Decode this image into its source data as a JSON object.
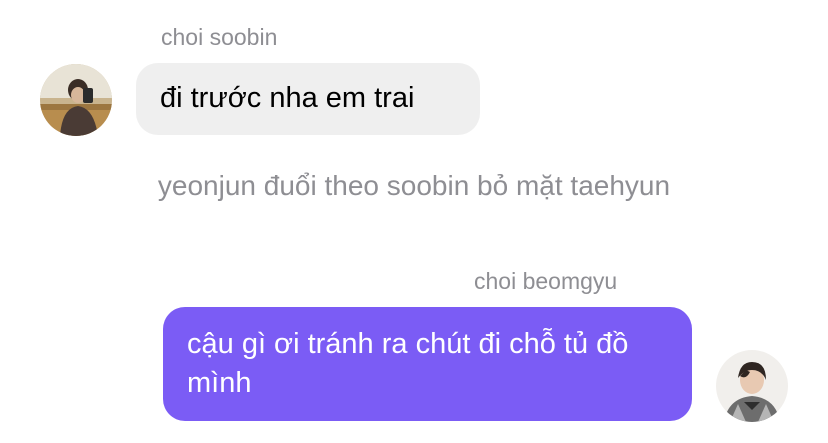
{
  "messages": [
    {
      "sender": "choi soobin",
      "text": "đi trước nha em trai",
      "direction": "incoming",
      "avatar": "soobin-profile-photo"
    },
    {
      "sender": "choi beomgyu",
      "text": "cậu gì ơi tránh ra chút đi chỗ tủ đồ mình",
      "direction": "outgoing",
      "avatar": "beomgyu-profile-photo"
    }
  ],
  "system_message": "yeonjun đuổi theo soobin bỏ mặt taehyun",
  "colors": {
    "incoming_bubble": "#efefef",
    "outgoing_bubble": "#7b5cf5",
    "meta_text": "#8e8e93"
  }
}
